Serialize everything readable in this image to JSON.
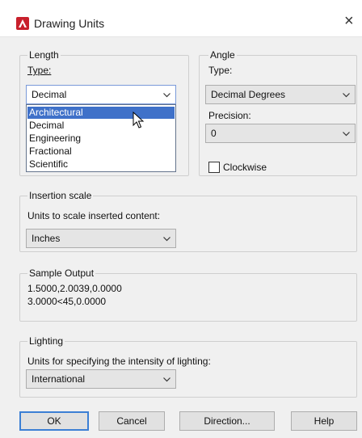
{
  "window": {
    "title": "Drawing Units",
    "close_glyph": "×"
  },
  "length": {
    "group_label": "Length",
    "type_label": "Type:",
    "type_value": "Decimal",
    "options": [
      "Architectural",
      "Decimal",
      "Engineering",
      "Fractional",
      "Scientific"
    ],
    "highlighted_option": "Architectural"
  },
  "angle": {
    "group_label": "Angle",
    "type_label": "Type:",
    "type_value": "Decimal Degrees",
    "precision_label": "Precision:",
    "precision_value": "0",
    "clockwise_label": "Clockwise",
    "clockwise_checked": false
  },
  "insertion": {
    "group_label": "Insertion scale",
    "units_label": "Units to scale inserted content:",
    "units_value": "Inches"
  },
  "sample": {
    "group_label": "Sample Output",
    "line1": "1.5000,2.0039,0.0000",
    "line2": "3.0000<45,0.0000"
  },
  "lighting": {
    "group_label": "Lighting",
    "units_label": "Units for specifying the intensity of lighting:",
    "units_value": "International"
  },
  "buttons": {
    "ok": "OK",
    "cancel": "Cancel",
    "direction": "Direction...",
    "help": "Help"
  },
  "colors": {
    "app_icon": "#c8202c",
    "highlight": "#3f71c9",
    "focus_border": "#7a9ad9"
  },
  "icons": [
    "app-icon",
    "close-icon",
    "chevron-down-icon",
    "mouse-cursor-icon"
  ]
}
